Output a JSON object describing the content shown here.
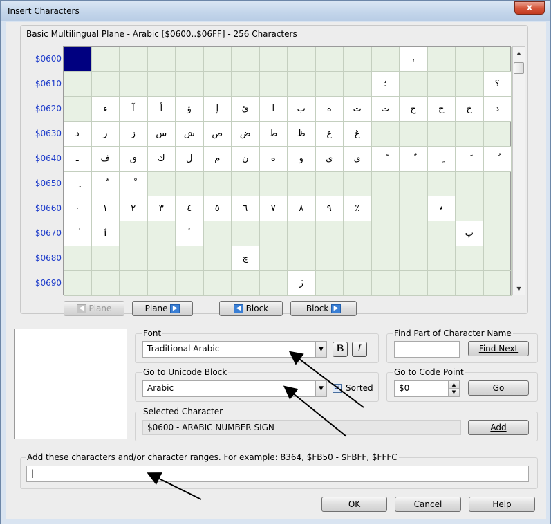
{
  "window": {
    "title": "Insert Characters",
    "close_label": "x"
  },
  "grid_section": {
    "title": "Basic Multilingual Plane - Arabic [$0600..$06FF] - 256 Characters",
    "rows": [
      {
        "label": "$0600",
        "cells": [
          "",
          "",
          "",
          "",
          "",
          "",
          "",
          "",
          "",
          "",
          "",
          "",
          "،",
          "",
          "",
          ""
        ]
      },
      {
        "label": "$0610",
        "cells": [
          "",
          "",
          "",
          "",
          "",
          "",
          "",
          "",
          "",
          "",
          "",
          "؛",
          "",
          "",
          "",
          "؟"
        ]
      },
      {
        "label": "$0620",
        "cells": [
          "",
          "ء",
          "آ",
          "أ",
          "ؤ",
          "إ",
          "ئ",
          "ا",
          "ب",
          "ة",
          "ت",
          "ث",
          "ج",
          "ح",
          "خ",
          "د"
        ]
      },
      {
        "label": "$0630",
        "cells": [
          "ذ",
          "ر",
          "ز",
          "س",
          "ش",
          "ص",
          "ض",
          "ط",
          "ظ",
          "ع",
          "غ",
          "",
          "",
          "",
          "",
          ""
        ]
      },
      {
        "label": "$0640",
        "cells": [
          "ـ",
          "ف",
          "ق",
          "ك",
          "ل",
          "م",
          "ن",
          "ه",
          "و",
          "ى",
          "ي",
          "ً",
          "ٌ",
          "ٍ",
          "َ",
          "ُ"
        ]
      },
      {
        "label": "$0650",
        "cells": [
          "ِ",
          "ّ",
          "ْ",
          "",
          "",
          "",
          "",
          "",
          "",
          "",
          "",
          "",
          "",
          "",
          "",
          ""
        ]
      },
      {
        "label": "$0660",
        "cells": [
          "٠",
          "١",
          "٢",
          "٣",
          "٤",
          "٥",
          "٦",
          "٧",
          "٨",
          "٩",
          "٪",
          "",
          "",
          "٭",
          "",
          ""
        ]
      },
      {
        "label": "$0670",
        "cells": [
          "ٰ",
          "ٱ",
          "",
          "",
          "ٴ",
          "",
          "",
          "",
          "",
          "",
          "",
          "",
          "",
          "",
          "پ",
          ""
        ]
      },
      {
        "label": "$0680",
        "cells": [
          "",
          "",
          "",
          "",
          "",
          "",
          "چ",
          "",
          "",
          "",
          "",
          "",
          "",
          "",
          "",
          ""
        ]
      },
      {
        "label": "$0690",
        "cells": [
          "",
          "",
          "",
          "",
          "",
          "",
          "",
          "",
          "ژ",
          "",
          "",
          "",
          "",
          "",
          "",
          ""
        ]
      }
    ],
    "filled": [
      [
        1,
        0,
        0,
        0,
        0,
        0,
        0,
        0,
        0,
        0,
        0,
        0,
        1,
        0,
        0,
        0
      ],
      [
        0,
        0,
        0,
        0,
        0,
        0,
        0,
        0,
        0,
        0,
        0,
        1,
        0,
        0,
        0,
        1
      ],
      [
        0,
        1,
        1,
        1,
        1,
        1,
        1,
        1,
        1,
        1,
        1,
        1,
        1,
        1,
        1,
        1
      ],
      [
        1,
        1,
        1,
        1,
        1,
        1,
        1,
        1,
        1,
        1,
        1,
        0,
        0,
        0,
        0,
        0
      ],
      [
        1,
        1,
        1,
        1,
        1,
        1,
        1,
        1,
        1,
        1,
        1,
        1,
        1,
        1,
        1,
        1
      ],
      [
        1,
        1,
        1,
        0,
        0,
        0,
        0,
        0,
        0,
        0,
        0,
        0,
        0,
        0,
        0,
        0
      ],
      [
        1,
        1,
        1,
        1,
        1,
        1,
        1,
        1,
        1,
        1,
        1,
        0,
        0,
        1,
        0,
        0
      ],
      [
        1,
        1,
        0,
        0,
        1,
        0,
        0,
        0,
        0,
        0,
        0,
        0,
        0,
        0,
        1,
        0
      ],
      [
        0,
        0,
        0,
        0,
        0,
        0,
        1,
        0,
        0,
        0,
        0,
        0,
        0,
        0,
        0,
        0
      ],
      [
        0,
        0,
        0,
        0,
        0,
        0,
        0,
        0,
        1,
        0,
        0,
        0,
        0,
        0,
        0,
        0
      ]
    ]
  },
  "nav": {
    "plane_prev": "Plane",
    "plane_next": "Plane",
    "block_prev": "Block",
    "block_next": "Block"
  },
  "font": {
    "label": "Font",
    "value": "Traditional Arabic",
    "bold_label": "B",
    "italic_label": "I"
  },
  "find": {
    "label": "Find Part of Character Name",
    "value": "",
    "button_label": "Find Next"
  },
  "unicode_block": {
    "label": "Go to Unicode Block",
    "value": "Arabic",
    "sorted_label": "Sorted",
    "sorted_checked": true
  },
  "code_point": {
    "label": "Go to Code Point",
    "value": "$0",
    "button_label": "Go"
  },
  "selected": {
    "label": "Selected Character",
    "value": "$0600 - ARABIC NUMBER SIGN",
    "add_label": "Add"
  },
  "ranges": {
    "label": "Add these characters and/or character ranges. For example: 8364, $FB50 - $FBFF, $FFFC",
    "value": ""
  },
  "footer": {
    "ok": "OK",
    "cancel": "Cancel",
    "help": "Help"
  }
}
